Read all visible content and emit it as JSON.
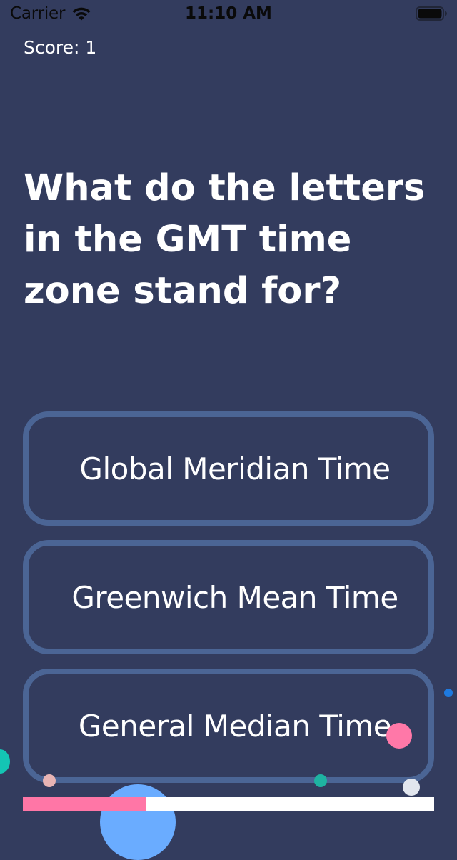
{
  "status_bar": {
    "carrier": "Carrier",
    "time": "11:10 AM",
    "wifi_icon": "wifi-icon",
    "battery_icon": "battery-icon"
  },
  "score": {
    "label": "Score: 1"
  },
  "question": {
    "text": "What do the letters in the GMT time zone stand for?"
  },
  "answers": [
    {
      "label": "Global Meridian Time"
    },
    {
      "label": "Greenwich Mean Time"
    },
    {
      "label": "General Median Time"
    }
  ],
  "progress": {
    "fraction": 0.3
  },
  "colors": {
    "background": "#333c5e",
    "answer_border": "#4b6595",
    "progress_fill": "#ff76a6",
    "progress_track": "#ffffff"
  }
}
